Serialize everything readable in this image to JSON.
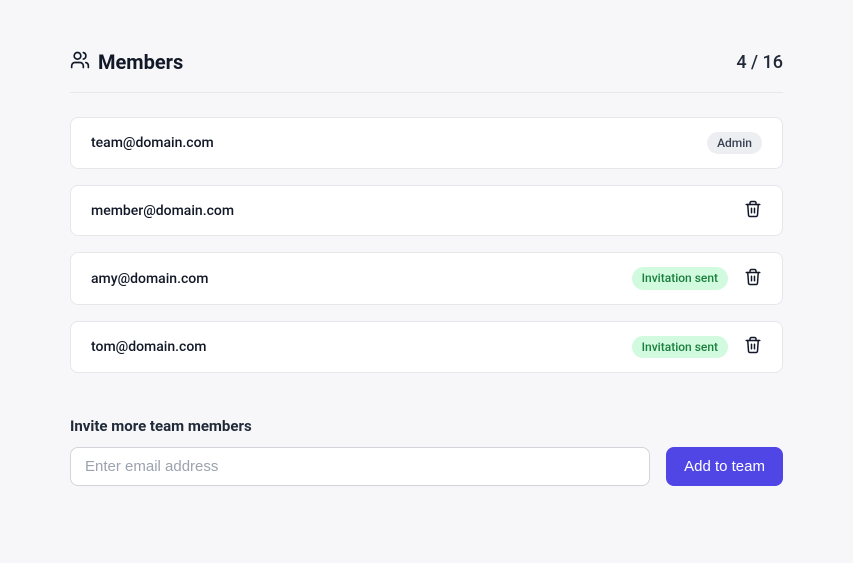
{
  "header": {
    "title": "Members",
    "count": "4 / 16"
  },
  "members": [
    {
      "email": "team@domain.com",
      "badge": "Admin",
      "badgeType": "admin",
      "removable": false
    },
    {
      "email": "member@domain.com",
      "badge": null,
      "badgeType": null,
      "removable": true
    },
    {
      "email": "amy@domain.com",
      "badge": "Invitation sent",
      "badgeType": "invite",
      "removable": true
    },
    {
      "email": "tom@domain.com",
      "badge": "Invitation sent",
      "badgeType": "invite",
      "removable": true
    }
  ],
  "invite": {
    "label": "Invite more team members",
    "placeholder": "Enter email address",
    "button": "Add to team"
  }
}
